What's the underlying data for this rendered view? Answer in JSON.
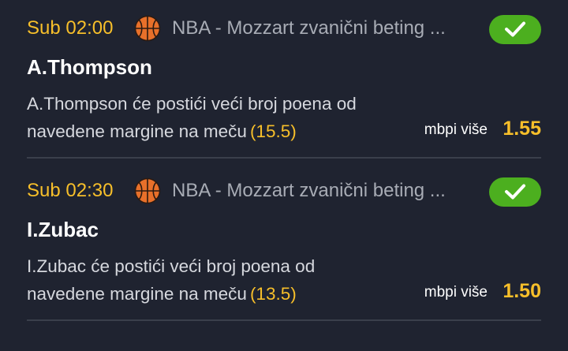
{
  "colors": {
    "background": "#1f2330",
    "accent": "#f7bf2a",
    "success": "#4caf1f",
    "muted": "#a8acb5"
  },
  "bets": [
    {
      "time": "Sub 02:00",
      "sport_icon": "basketball-icon",
      "league": "NBA - Mozzart zvanični beting ...",
      "status_icon": "check-icon",
      "player": "A.Thompson",
      "description": "A.Thompson će postići veći broj poena od navedene margine na meču",
      "margin": "(15.5)",
      "odds_label": "mbpi više",
      "odds": "1.55"
    },
    {
      "time": "Sub 02:30",
      "sport_icon": "basketball-icon",
      "league": "NBA - Mozzart zvanični beting ...",
      "status_icon": "check-icon",
      "player": "I.Zubac",
      "description": "I.Zubac će postići veći broj poena od navedene margine na meču",
      "margin": "(13.5)",
      "odds_label": "mbpi više",
      "odds": "1.50"
    }
  ]
}
